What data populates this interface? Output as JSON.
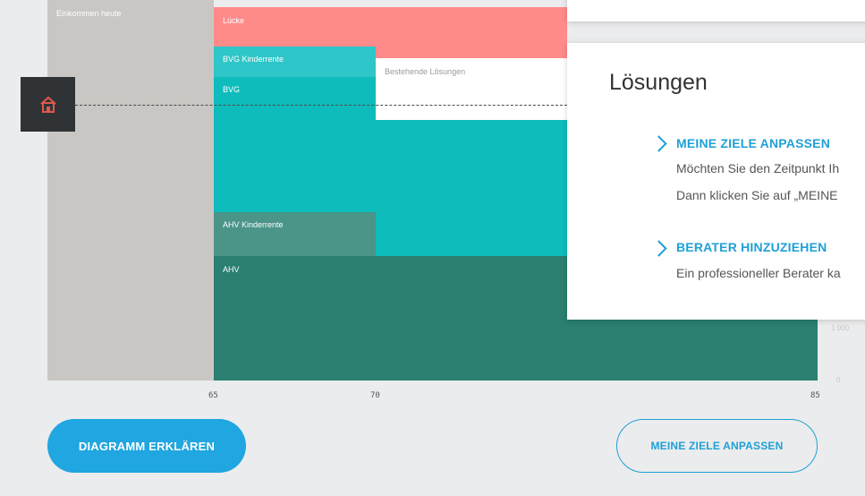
{
  "chart": {
    "segments": {
      "income_today": "Einkommen heute",
      "gap": "Lücke",
      "bvg_child": "BVG Kinderrente",
      "bvg": "BVG",
      "existing": "Bestehende Lösungen",
      "ahv_child": "AHV Kinderrente",
      "ahv": "AHV"
    },
    "x_ticks": [
      "65",
      "70",
      "85"
    ],
    "y_ticks": [
      "1 000",
      "0"
    ]
  },
  "solutions": {
    "title": "Lösungen",
    "items": [
      {
        "heading": "MEINE ZIELE ANPASSEN",
        "lines": [
          "Möchten Sie den Zeitpunkt Ih",
          "Dann klicken Sie auf „MEINE"
        ]
      },
      {
        "heading": "BERATER HINZUZIEHEN",
        "lines": [
          "Ein professioneller Berater ka"
        ]
      }
    ]
  },
  "buttons": {
    "explain": "DIAGRAMM ERKLÄREN",
    "adjust": "MEINE ZIELE ANPASSEN"
  },
  "icons": {
    "home": "home-icon",
    "chevron": "chevron-right-icon"
  },
  "colors": {
    "gap": "#ff8a8a",
    "bvg": "#0fbcbc",
    "bvg_child": "#2ec6c8",
    "ahv": "#2a7f70",
    "ahv_child": "#4a9488",
    "income": "#c9c7c3",
    "accent": "#1fa0d6"
  }
}
